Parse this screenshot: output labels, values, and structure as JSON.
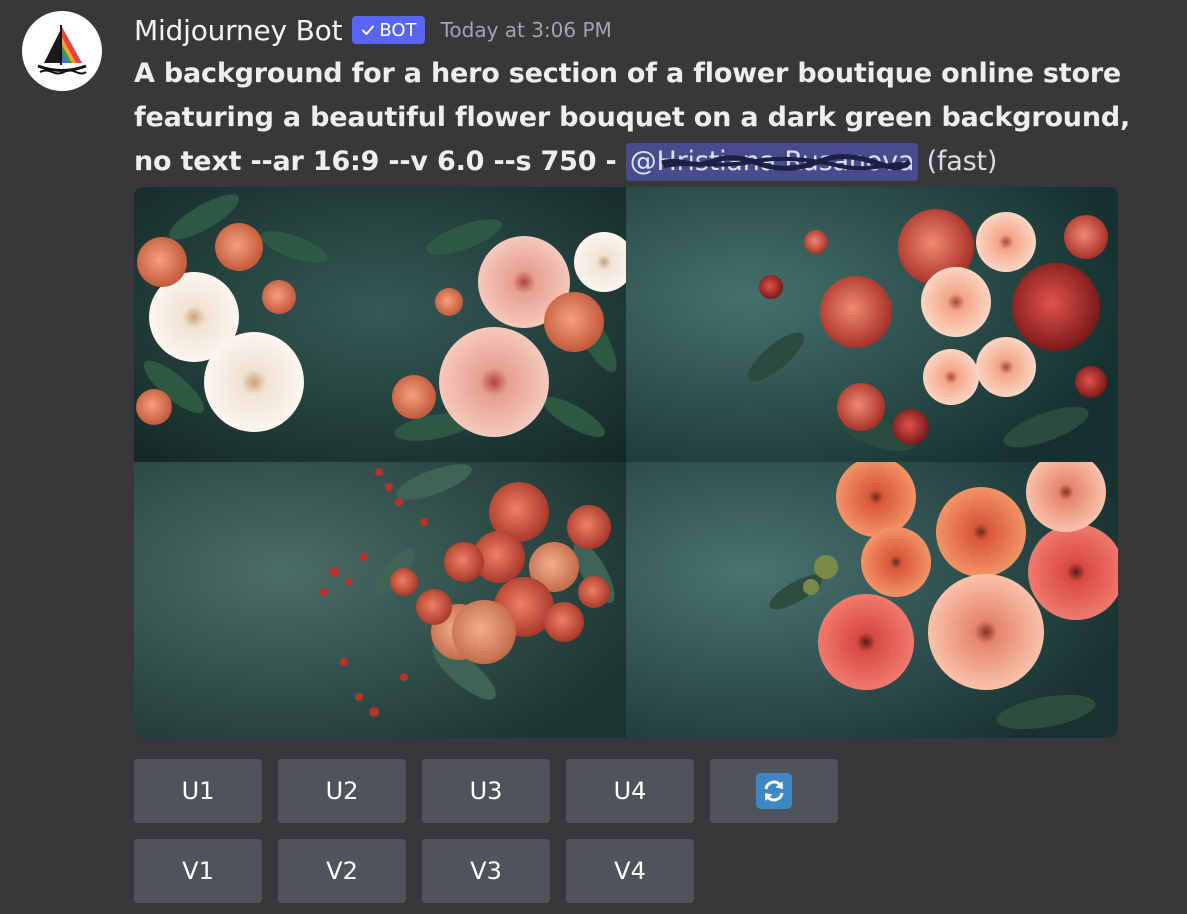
{
  "message": {
    "author": "Midjourney Bot",
    "badge": "BOT",
    "timestamp": "Today at 3:06 PM",
    "prompt_text": "A background for a hero section of a flower boutique online store featuring a beautiful flower bouquet on a dark green background, no text --ar 16:9 --v 6.0 --s 750 - ",
    "mention": "@Hristiana Rusanova",
    "suffix": " (fast)"
  },
  "image_grid": {
    "tiles": [
      {
        "icon": "flower-image-1"
      },
      {
        "icon": "flower-image-2"
      },
      {
        "icon": "flower-image-3"
      },
      {
        "icon": "flower-image-4"
      }
    ]
  },
  "buttons": {
    "upscale": [
      "U1",
      "U2",
      "U3",
      "U4"
    ],
    "variation": [
      "V1",
      "V2",
      "V3",
      "V4"
    ],
    "reroll_icon": "refresh-icon"
  },
  "colors": {
    "background": "#38383a",
    "badge": "#5865f2",
    "button": "#4f545c",
    "mention": "#5865f2",
    "refresh": "#3b88c3"
  }
}
